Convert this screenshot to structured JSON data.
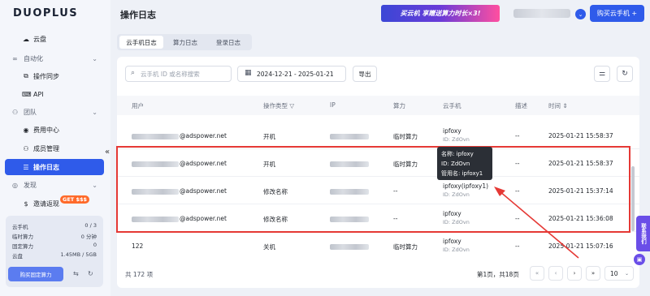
{
  "sidebar": {
    "logo": "DUOPLUS",
    "items": [
      {
        "label": "云盘",
        "icon": "cloud-icon",
        "glyph": "☁"
      },
      {
        "label": "操作同步",
        "icon": "sync-icon",
        "glyph": "⧉"
      },
      {
        "label": "API",
        "icon": "api-icon",
        "glyph": "⌨"
      },
      {
        "label": "费用中心",
        "icon": "dollar-icon",
        "glyph": "◉"
      },
      {
        "label": "成员管理",
        "icon": "users-icon",
        "glyph": "⚇"
      },
      {
        "label": "操作日志",
        "icon": "log-icon",
        "glyph": "☰"
      },
      {
        "label": "邀请返现",
        "icon": "cash-icon",
        "glyph": "$"
      }
    ],
    "groups": [
      {
        "label": "自动化",
        "icon": "automation-icon",
        "glyph": "∞"
      },
      {
        "label": "团队",
        "icon": "team-icon",
        "glyph": "⚇"
      },
      {
        "label": "发现",
        "icon": "discover-icon",
        "glyph": "◎"
      }
    ],
    "badge": "GET $$$",
    "stats": [
      {
        "label": "云手机",
        "value": "0 / 3"
      },
      {
        "label": "临时算力",
        "value": "0 分钟"
      },
      {
        "label": "固定算力",
        "value": "0"
      },
      {
        "label": "云盘",
        "value": "1.45MB / 5GB"
      }
    ],
    "buy_fixed": "购买固定算力",
    "collapse": "«"
  },
  "header": {
    "title": "操作日志",
    "promo": "买云机 享赠送算力时长×3!",
    "buy_button": "购买云手机 +"
  },
  "tabs": [
    "云手机日志",
    "算力日志",
    "登录日志"
  ],
  "toolbar": {
    "search_placeholder": "云手机 ID 或名称搜索",
    "date_range": "2024-12-21 - 2025-01-21",
    "export": "导出"
  },
  "table": {
    "columns": [
      "用户",
      "操作类型",
      "IP",
      "算力",
      "云手机",
      "描述",
      "时间"
    ],
    "rows": [
      {
        "user": "@adspower.net",
        "op": "开机",
        "compute": "临时算力",
        "phone": "ipfoxy",
        "phone_id": "ID: ZdOvn",
        "desc": "--",
        "time": "2025-01-21 15:58:37"
      },
      {
        "user": "@adspower.net",
        "op": "开机",
        "compute": "临时算力",
        "phone": "",
        "phone_id": "",
        "desc": "--",
        "time": "2025-01-21 15:58:37"
      },
      {
        "user": "@adspower.net",
        "op": "修改名称",
        "compute": "--",
        "phone": "ipfoxy(ipfoxy1)",
        "phone_id": "ID: ZdOvn",
        "desc": "--",
        "time": "2025-01-21 15:37:14"
      },
      {
        "user": "@adspower.net",
        "op": "修改名称",
        "compute": "--",
        "phone": "ipfoxy",
        "phone_id": "ID: ZdOvn",
        "desc": "--",
        "time": "2025-01-21 15:36:08"
      },
      {
        "user": "122",
        "op": "关机",
        "compute": "临时算力",
        "phone": "ipfoxy",
        "phone_id": "ID: ZdOvn",
        "desc": "--",
        "time": "2025-01-21 15:07:16"
      }
    ]
  },
  "tooltip": {
    "name": "名称: ipfoxy",
    "id": "ID: ZdOvn",
    "alias": "管用名: ipfoxy1"
  },
  "footer": {
    "total": "共 172 项",
    "pager": "第1页，共18页",
    "page_size": "10"
  },
  "side_tab": "联系我们",
  "colors": {
    "accent": "#2f5bea",
    "highlight": "#e53935"
  }
}
